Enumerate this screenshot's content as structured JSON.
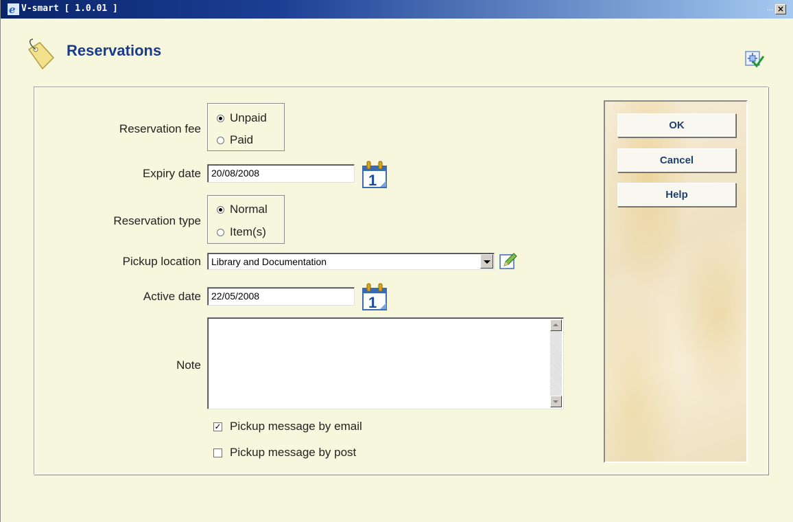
{
  "window": {
    "title": "V-smart [ 1.0.01 ]",
    "controls_ellipsis": "...",
    "close_glyph": "×"
  },
  "header": {
    "title": "Reservations",
    "icon": "tag-icon",
    "corner_icon": "form-check-icon"
  },
  "form": {
    "reservation_fee": {
      "label": "Reservation fee",
      "options": [
        "Unpaid",
        "Paid"
      ],
      "selected": "Unpaid"
    },
    "expiry_date": {
      "label": "Expiry date",
      "value": "20/08/2008"
    },
    "reservation_type": {
      "label": "Reservation type",
      "options": [
        "Normal",
        "Item(s)"
      ],
      "selected": "Normal"
    },
    "pickup_location": {
      "label": "Pickup location",
      "value": "Library and Documentation"
    },
    "active_date": {
      "label": "Active date",
      "value": "22/05/2008"
    },
    "note": {
      "label": "Note",
      "value": ""
    },
    "pickup_email": {
      "label": "Pickup message by email",
      "checked": true,
      "mark": "✓"
    },
    "pickup_post": {
      "label": "Pickup message by post",
      "checked": false,
      "mark": ""
    }
  },
  "buttons": {
    "ok": "OK",
    "cancel": "Cancel",
    "help": "Help"
  },
  "colors": {
    "title_blue": "#1a3a8c",
    "window_bg": "#f7f7de",
    "button_text": "#1f3f6e"
  }
}
